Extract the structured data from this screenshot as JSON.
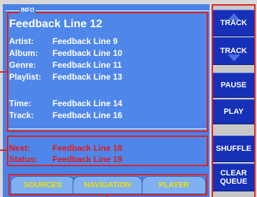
{
  "info": {
    "legend": "INFO",
    "headline": "Feedback Line 12",
    "rows": [
      {
        "label": "Artist:",
        "value": "Feedback Line 9"
      },
      {
        "label": "Album:",
        "value": "Feedback Line 10"
      },
      {
        "label": "Genre:",
        "value": "Feedback Line 11"
      },
      {
        "label": "Playlist:",
        "value": "Feedback Line 13"
      },
      {
        "label": "Time:",
        "value": "Feedback Line 14"
      },
      {
        "label": "Track:",
        "value": "Feedback Line 16"
      }
    ]
  },
  "status": {
    "rows": [
      {
        "label": "Next:",
        "value": "Feedback Line 18"
      },
      {
        "label": "Status:",
        "value": "Feedback Line 19"
      }
    ]
  },
  "tabs": [
    "SOURCES",
    "NAVIGATION",
    "PLAYER"
  ],
  "side_buttons": {
    "track_up": "TRACK",
    "track_down": "TRACK",
    "pause": "PAUSE",
    "play": "PLAY",
    "shuffle": "SHUFFLE",
    "clear_queue": "CLEAR QUEUE"
  },
  "colors": {
    "panel_blue": "#4a82e6",
    "button_blue": "#1630b8",
    "outline_red": "#dd2222",
    "tab_text_yellow": "#f0e000",
    "status_text_red": "#e01a1a"
  }
}
